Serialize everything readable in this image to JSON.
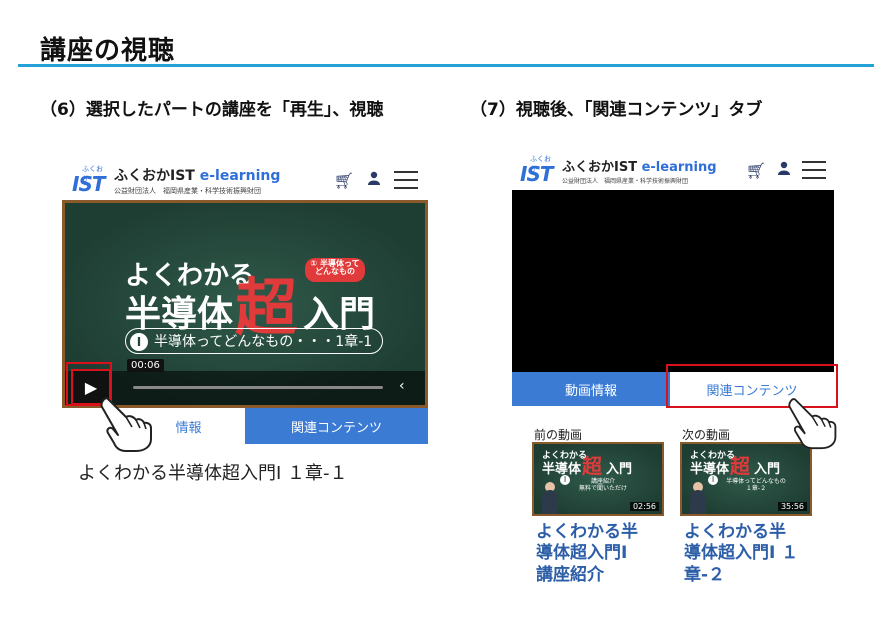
{
  "page_title": "講座の視聴",
  "steps": {
    "left": "（6）選択したパートの講座を「再生」、視聴",
    "right": "（7）視聴後、「関連コンテンツ」タブ"
  },
  "header": {
    "logo_small": "ふくおか",
    "logo_ist": "IST",
    "logo_main_a": "ふくおかIST ",
    "logo_main_b": "e-learning",
    "logo_sub": "公益財団法人　福岡県産業・科学技術振興財団",
    "cart_icon": "cart-icon",
    "user_icon": "user-icon",
    "menu_icon": "hamburger-menu-icon"
  },
  "video": {
    "line_a": "よくわかる",
    "line_b": "半導体",
    "chou": "超",
    "line_c": "入門",
    "pill_num": "①",
    "pill_text": "半導体って\nどんなもの",
    "sub_num": "Ⅰ",
    "sub_text": "半導体ってどんなもの・・・1章-1",
    "time": "00:06",
    "play_symbol": "▶",
    "chev_symbol": "‹"
  },
  "tabs": {
    "info": "動画情報",
    "info_partial": "情報",
    "related": "関連コンテンツ"
  },
  "left_video_title": "よくわかる半導体超入門Ⅰ １章-１",
  "related": {
    "prev_label": "前の動画",
    "next_label": "次の動画",
    "prev": {
      "thumb_a": "よくわかる",
      "thumb_b": "半導体",
      "thumb_chou": "超",
      "thumb_c": "入門",
      "thumb_sub": "講座紹介\n無料で聞いただけ",
      "thumb_num": "Ⅰ",
      "duration": "02:56",
      "title": "よくわかる半\n導体超入門Ⅰ\n講座紹介"
    },
    "next": {
      "thumb_a": "よくわかる",
      "thumb_b": "半導体",
      "thumb_chou": "超",
      "thumb_c": "入門",
      "thumb_sub": "半導体ってどんなもの\n１章-２",
      "thumb_num": "Ⅰ",
      "duration": "35:56",
      "title": "よくわかる半\n導体超入門Ⅰ １\n章-２"
    }
  },
  "colors": {
    "accent_rule": "#22a2d8",
    "tab_blue": "#3b7bd4",
    "highlight_red": "#d9111a",
    "board_green": "#24463a"
  }
}
